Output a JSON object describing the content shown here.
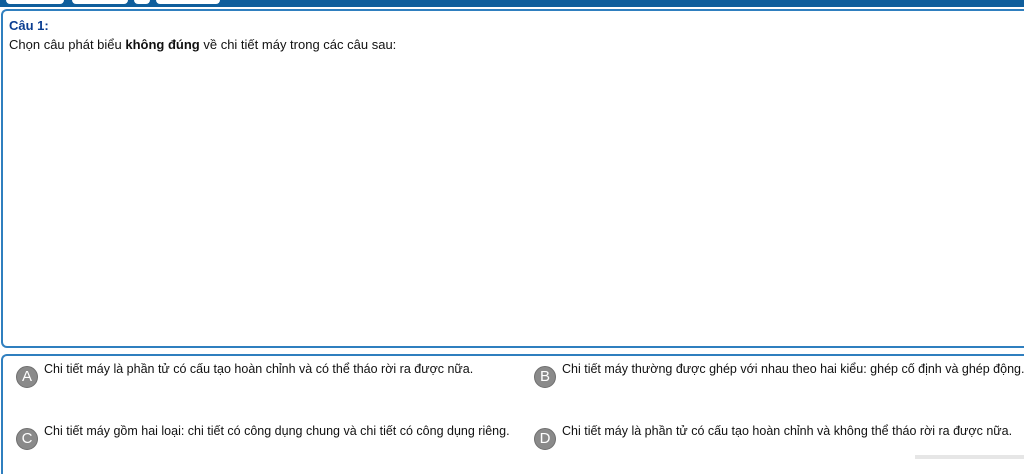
{
  "question": {
    "number_label": "Câu 1:",
    "text_before": "Chọn câu phát biểu ",
    "text_bold": "không đúng",
    "text_after": " về chi tiết máy trong các câu sau:"
  },
  "answers": [
    {
      "letter": "A",
      "text": "Chi tiết máy là phần tử có cấu tạo hoàn chỉnh và có thể tháo rời ra được nữa."
    },
    {
      "letter": "B",
      "text": "Chi tiết máy thường được ghép với nhau theo hai kiểu: ghép cố định và ghép động."
    },
    {
      "letter": "C",
      "text": "Chi tiết máy gồm hai loại: chi tiết có công dụng chung và chi tiết có công dụng riêng."
    },
    {
      "letter": "D",
      "text": "Chi tiết máy là phần tử có cấu tạo hoàn chỉnh và không thể tháo rời ra được nữa."
    }
  ],
  "colors": {
    "header_bar": "#0f5e9c",
    "panel_border": "#2f7fbf",
    "question_label": "#0a3d91",
    "answer_badge": "#8a8a8a"
  }
}
